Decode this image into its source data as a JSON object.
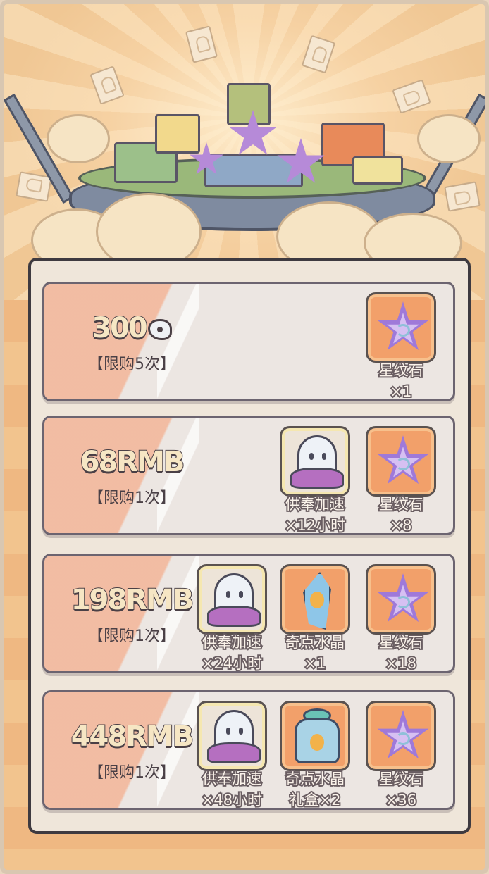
{
  "header": {
    "decor": [
      "ghost-ticket-icon",
      "cloud-icon",
      "gift-box-icon",
      "star-stone-icon",
      "stage-platform"
    ]
  },
  "offers": [
    {
      "price": "300",
      "price_icon": "ghost-coin-icon",
      "limit": "【限购5次】",
      "items": [
        {
          "icon": "star-stone-icon",
          "name": "星纹石",
          "qty": "×1"
        }
      ]
    },
    {
      "price": "68RMB",
      "limit": "【限购1次】",
      "items": [
        {
          "icon": "ghost-speedup-icon",
          "name": "供奉加速",
          "qty": "×12小时"
        },
        {
          "icon": "star-stone-icon",
          "name": "星纹石",
          "qty": "×8"
        }
      ]
    },
    {
      "price": "198RMB",
      "limit": "【限购1次】",
      "items": [
        {
          "icon": "ghost-speedup-icon",
          "name": "供奉加速",
          "qty": "×24小时"
        },
        {
          "icon": "crystal-icon",
          "name": "奇点水晶",
          "qty": "×1"
        },
        {
          "icon": "star-stone-icon",
          "name": "星纹石",
          "qty": "×18"
        }
      ]
    },
    {
      "price": "448RMB",
      "limit": "【限购1次】",
      "items": [
        {
          "icon": "ghost-speedup-icon",
          "name": "供奉加速",
          "qty": "×48小时"
        },
        {
          "icon": "crystal-giftbox-icon",
          "name": "奇点水晶",
          "qty": "礼盒×2"
        },
        {
          "icon": "star-stone-icon",
          "name": "星纹石",
          "qty": "×36"
        }
      ]
    }
  ],
  "colors": {
    "card_bg": "#ece6e2",
    "stripe": "#f3b89c",
    "item_orange": "#f2a06a",
    "star_purple": "#9f79d9",
    "outline": "#4a4046"
  }
}
